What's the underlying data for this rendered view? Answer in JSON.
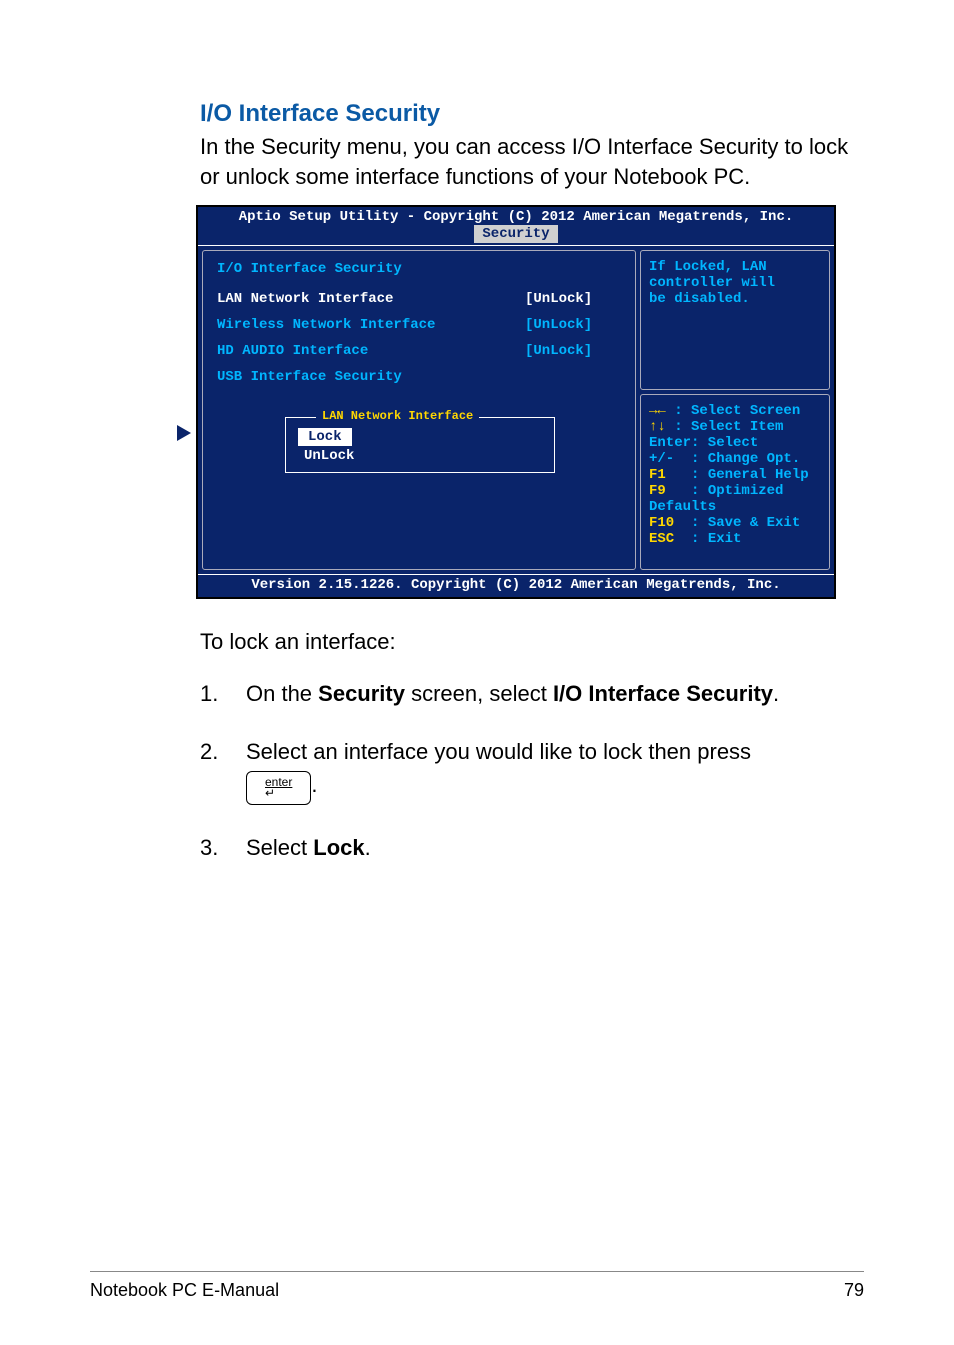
{
  "heading": "I/O Interface Security",
  "intro": "In the Security menu, you can access I/O Interface Security to lock or unlock some interface functions of your Notebook PC.",
  "bios": {
    "header": "Aptio Setup Utility - Copyright (C) 2012 American Megatrends, Inc.",
    "tab": "Security",
    "title": "I/O Interface Security",
    "rows": [
      {
        "label": "LAN Network Interface",
        "value": "[UnLock]",
        "selected": true
      },
      {
        "label": "Wireless Network Interface",
        "value": "[UnLock]",
        "selected": false
      },
      {
        "label": "HD AUDIO Interface",
        "value": "[UnLock]",
        "selected": false
      }
    ],
    "submenu": "USB Interface Security",
    "popup": {
      "title": "LAN Network Interface",
      "items": [
        "Lock",
        "UnLock"
      ],
      "selected_index": 0
    },
    "help_lines": [
      "If Locked, LAN",
      "controller will",
      "be disabled."
    ],
    "keys": {
      "l1_a": "→←",
      "l1_b": " : Select Screen",
      "l2_a": "↑↓",
      "l2_b": " : Select Item",
      "l3": "Enter: Select",
      "l4": "+/-  : Change Opt.",
      "l5_a": "F1",
      "l5_b": "   : General Help",
      "l6_a": "F9",
      "l6_b": "   : Optimized",
      "l7": "Defaults",
      "l8_a": "F10",
      "l8_b": "  : Save & Exit",
      "l9_a": "ESC",
      "l9_b": "  : Exit"
    },
    "footer": "Version 2.15.1226. Copyright (C) 2012 American Megatrends, Inc."
  },
  "lock_intro": "To lock an interface:",
  "steps": {
    "s1_num": "1.",
    "s1_a": "On the ",
    "s1_b": "Security",
    "s1_c": " screen, select ",
    "s1_d": "I/O Interface Security",
    "s1_e": ".",
    "s2_num": "2.",
    "s2_a": "Select an interface you would like to lock then press",
    "s2_key_label": "enter",
    "s2_key_arrow": "↵",
    "s2_end": ".",
    "s3_num": "3.",
    "s3_a": "Select ",
    "s3_b": "Lock",
    "s3_c": "."
  },
  "footer_left": "Notebook PC E-Manual",
  "footer_right": "79"
}
